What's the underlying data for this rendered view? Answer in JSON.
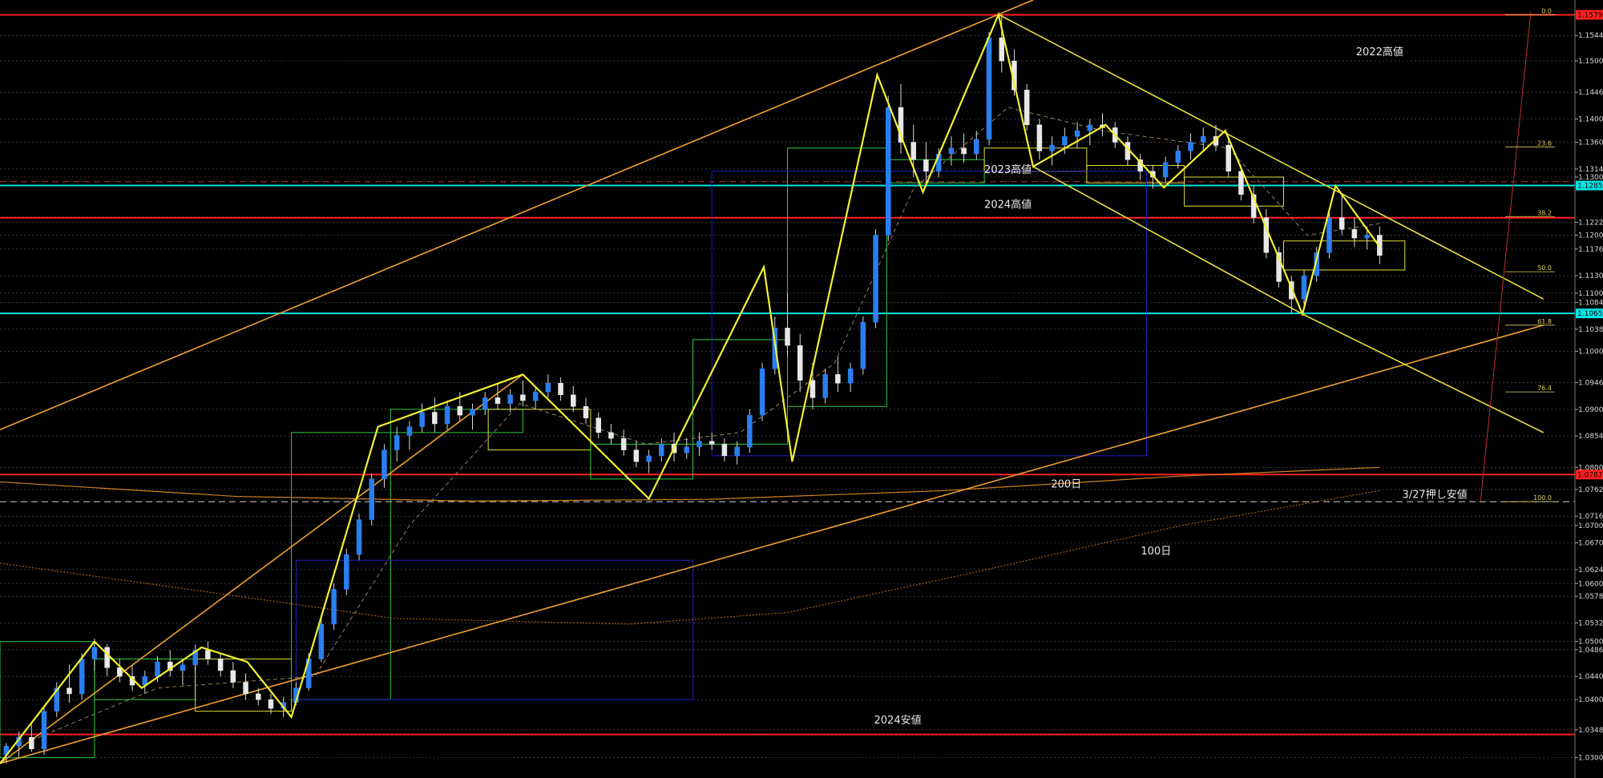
{
  "chart_data": {
    "type": "candlestick",
    "symbol": "",
    "yaxis": {
      "range": [
        1.0265,
        1.1605
      ],
      "tick_labels": [
        {
          "label": "1.15440",
          "value": 1.1544
        },
        {
          "label": "1.15000",
          "value": 1.15
        },
        {
          "label": "1.14460",
          "value": 1.1446
        },
        {
          "label": "1.14000",
          "value": 1.14
        },
        {
          "label": "1.13600",
          "value": 1.136
        },
        {
          "label": "1.13140",
          "value": 1.1314
        },
        {
          "label": "1.13000",
          "value": 1.13
        },
        {
          "label": "1.12220",
          "value": 1.1222
        },
        {
          "label": "1.12000",
          "value": 1.12
        },
        {
          "label": "1.11760",
          "value": 1.1176
        },
        {
          "label": "1.11300",
          "value": 1.113
        },
        {
          "label": "1.11000",
          "value": 1.11
        },
        {
          "label": "1.10840",
          "value": 1.1084
        },
        {
          "label": "1.10380",
          "value": 1.1038
        },
        {
          "label": "1.10000",
          "value": 1.1
        },
        {
          "label": "1.09460",
          "value": 1.0946
        },
        {
          "label": "1.09000",
          "value": 1.09
        },
        {
          "label": "1.08540",
          "value": 1.0854
        },
        {
          "label": "1.08000",
          "value": 1.08
        },
        {
          "label": "1.07620",
          "value": 1.0762
        },
        {
          "label": "1.07160",
          "value": 1.0716
        },
        {
          "label": "1.07000",
          "value": 1.07
        },
        {
          "label": "1.06700",
          "value": 1.067
        },
        {
          "label": "1.06240",
          "value": 1.0624
        },
        {
          "label": "1.06000",
          "value": 1.06
        },
        {
          "label": "1.05780",
          "value": 1.0578
        },
        {
          "label": "1.05320",
          "value": 1.0532
        },
        {
          "label": "1.05000",
          "value": 1.05
        },
        {
          "label": "1.04860",
          "value": 1.0486
        },
        {
          "label": "1.04400",
          "value": 1.044
        },
        {
          "label": "1.04000",
          "value": 1.04
        },
        {
          "label": "1.03480",
          "value": 1.0348
        },
        {
          "label": "1.03000",
          "value": 1.03
        }
      ],
      "highlight_labels": [
        {
          "label": "1.15795",
          "value": 1.15795,
          "color": "#ff2020"
        },
        {
          "label": "1.12855",
          "value": 1.12855,
          "color": "#00e5e5"
        },
        {
          "label": "1.10652",
          "value": 1.10652,
          "color": "#00e5e5"
        },
        {
          "label": "1.07876",
          "value": 1.07876,
          "color": "#ff2020"
        }
      ]
    },
    "horizontal_levels": [
      {
        "value": 1.15795,
        "color": "#ff2020",
        "style": "solid"
      },
      {
        "value": 1.12855,
        "color": "#00e5e5",
        "style": "solid"
      },
      {
        "value": 1.123,
        "color": "#ff2020",
        "style": "solid"
      },
      {
        "value": 1.10652,
        "color": "#00e5e5",
        "style": "solid"
      },
      {
        "value": 1.07876,
        "color": "#ff2020",
        "style": "solid"
      },
      {
        "value": 1.034,
        "color": "#ff2020",
        "style": "solid"
      },
      {
        "value": 1.1292,
        "color": "#b03030",
        "style": "dashed"
      },
      {
        "value": 1.0741,
        "color": "#d8d8d8",
        "style": "dashed"
      }
    ],
    "annotations": [
      {
        "text": "2022高値",
        "x": 0.876,
        "y": 1.151
      },
      {
        "text": "2023高値",
        "x": 0.64,
        "y": 1.1307
      },
      {
        "text": "2024高値",
        "x": 0.64,
        "y": 1.1247
      },
      {
        "text": "200日",
        "x": 0.677,
        "y": 1.0765
      },
      {
        "text": "3/27押し安値",
        "x": 0.911,
        "y": 1.0747
      },
      {
        "text": "100日",
        "x": 0.734,
        "y": 1.065
      },
      {
        "text": "2024安値",
        "x": 0.57,
        "y": 1.0359
      }
    ],
    "fibonacci": [
      {
        "label": "0.0",
        "value": 1.15795
      },
      {
        "label": "23.6",
        "value": 1.1352
      },
      {
        "label": "38.2",
        "value": 1.1232
      },
      {
        "label": "50.0",
        "value": 1.1137
      },
      {
        "label": "61.8",
        "value": 1.1045
      },
      {
        "label": "76.4",
        "value": 1.093
      },
      {
        "label": "100.0",
        "value": 1.0741
      }
    ],
    "zigzag": [
      [
        0.0,
        1.029
      ],
      [
        0.06,
        1.05
      ],
      [
        0.09,
        1.042
      ],
      [
        0.128,
        1.049
      ],
      [
        0.157,
        1.0465
      ],
      [
        0.185,
        1.037
      ],
      [
        0.24,
        1.087
      ],
      [
        0.332,
        1.096
      ],
      [
        0.412,
        1.0746
      ],
      [
        0.485,
        1.1145
      ],
      [
        0.503,
        1.081
      ],
      [
        0.557,
        1.1476
      ],
      [
        0.586,
        1.1274
      ],
      [
        0.634,
        1.158
      ],
      [
        0.656,
        1.1318
      ],
      [
        0.702,
        1.139
      ],
      [
        0.739,
        1.1282
      ],
      [
        0.778,
        1.138
      ],
      [
        0.827,
        1.1064
      ],
      [
        0.848,
        1.1285
      ],
      [
        0.876,
        1.118
      ]
    ],
    "ohlc": [
      [
        0.004,
        1.0305,
        1.0325,
        1.029,
        1.032
      ],
      [
        0.012,
        1.032,
        1.0345,
        1.03,
        1.0335
      ],
      [
        0.02,
        1.0335,
        1.036,
        1.031,
        1.0315
      ],
      [
        0.028,
        1.0315,
        1.039,
        1.0305,
        1.038
      ],
      [
        0.036,
        1.038,
        1.043,
        1.037,
        1.042
      ],
      [
        0.044,
        1.042,
        1.046,
        1.0395,
        1.041
      ],
      [
        0.052,
        1.041,
        1.048,
        1.04,
        1.047
      ],
      [
        0.06,
        1.047,
        1.0505,
        1.045,
        1.049
      ],
      [
        0.068,
        1.049,
        1.0495,
        1.044,
        1.0455
      ],
      [
        0.076,
        1.0455,
        1.047,
        1.043,
        1.044
      ],
      [
        0.084,
        1.044,
        1.046,
        1.0415,
        1.0425
      ],
      [
        0.092,
        1.0425,
        1.045,
        1.041,
        1.044
      ],
      [
        0.1,
        1.044,
        1.0475,
        1.043,
        1.0465
      ],
      [
        0.108,
        1.0465,
        1.0485,
        1.044,
        1.045
      ],
      [
        0.116,
        1.045,
        1.047,
        1.0425,
        1.046
      ],
      [
        0.124,
        1.046,
        1.0495,
        1.045,
        1.0485
      ],
      [
        0.132,
        1.0485,
        1.05,
        1.046,
        1.047
      ],
      [
        0.14,
        1.047,
        1.048,
        1.044,
        1.045
      ],
      [
        0.148,
        1.045,
        1.0465,
        1.042,
        1.043
      ],
      [
        0.156,
        1.043,
        1.0445,
        1.04,
        1.041
      ],
      [
        0.164,
        1.041,
        1.042,
        1.039,
        1.04
      ],
      [
        0.172,
        1.04,
        1.041,
        1.0375,
        1.0385
      ],
      [
        0.18,
        1.0385,
        1.0405,
        1.037,
        1.0395
      ],
      [
        0.188,
        1.0395,
        1.043,
        1.039,
        1.042
      ],
      [
        0.196,
        1.042,
        1.048,
        1.0415,
        1.047
      ],
      [
        0.204,
        1.047,
        1.054,
        1.0465,
        1.053
      ],
      [
        0.212,
        1.053,
        1.06,
        1.052,
        1.059
      ],
      [
        0.22,
        1.059,
        1.066,
        1.058,
        1.065
      ],
      [
        0.228,
        1.065,
        1.072,
        1.064,
        1.071
      ],
      [
        0.236,
        1.071,
        1.079,
        1.07,
        1.078
      ],
      [
        0.244,
        1.078,
        1.084,
        1.0765,
        1.083
      ],
      [
        0.252,
        1.083,
        1.087,
        1.081,
        1.0855
      ],
      [
        0.26,
        1.0855,
        1.088,
        1.083,
        1.087
      ],
      [
        0.268,
        1.087,
        1.091,
        1.086,
        1.0895
      ],
      [
        0.276,
        1.0895,
        1.092,
        1.086,
        1.0875
      ],
      [
        0.284,
        1.0875,
        1.0915,
        1.0865,
        1.0905
      ],
      [
        0.292,
        1.0905,
        1.093,
        1.088,
        1.089
      ],
      [
        0.3,
        1.089,
        1.091,
        1.0865,
        1.09
      ],
      [
        0.308,
        1.09,
        1.093,
        1.089,
        1.092
      ],
      [
        0.316,
        1.092,
        1.0945,
        1.09,
        1.091
      ],
      [
        0.324,
        1.091,
        1.0935,
        1.0895,
        1.0925
      ],
      [
        0.332,
        1.0925,
        1.095,
        1.0905,
        1.0915
      ],
      [
        0.34,
        1.0915,
        1.094,
        1.09,
        1.093
      ],
      [
        0.348,
        1.093,
        1.096,
        1.092,
        1.0945
      ],
      [
        0.356,
        1.0945,
        1.0955,
        1.0915,
        1.0925
      ],
      [
        0.364,
        1.0925,
        1.094,
        1.0895,
        1.0905
      ],
      [
        0.372,
        1.0905,
        1.092,
        1.0875,
        1.0885
      ],
      [
        0.38,
        1.0885,
        1.0895,
        1.085,
        1.086
      ],
      [
        0.388,
        1.086,
        1.0875,
        1.084,
        1.085
      ],
      [
        0.396,
        1.085,
        1.0865,
        1.082,
        1.083
      ],
      [
        0.404,
        1.083,
        1.0845,
        1.08,
        1.081
      ],
      [
        0.412,
        1.081,
        1.083,
        1.079,
        1.082
      ],
      [
        0.42,
        1.082,
        1.085,
        1.081,
        1.084
      ],
      [
        0.428,
        1.084,
        1.086,
        1.081,
        1.0825
      ],
      [
        0.436,
        1.0825,
        1.085,
        1.0815,
        1.0835
      ],
      [
        0.444,
        1.0835,
        1.086,
        1.082,
        1.0845
      ],
      [
        0.452,
        1.0845,
        1.086,
        1.083,
        1.084
      ],
      [
        0.46,
        1.084,
        1.085,
        1.081,
        1.082
      ],
      [
        0.468,
        1.082,
        1.0845,
        1.0805,
        1.0835
      ],
      [
        0.476,
        1.0835,
        1.09,
        1.0825,
        1.089
      ],
      [
        0.484,
        1.089,
        1.098,
        1.088,
        1.097
      ],
      [
        0.492,
        1.097,
        1.106,
        1.096,
        1.104
      ],
      [
        0.5,
        1.104,
        1.11,
        1.099,
        1.101
      ],
      [
        0.508,
        1.101,
        1.103,
        1.093,
        1.095
      ],
      [
        0.516,
        1.095,
        1.098,
        1.09,
        1.092
      ],
      [
        0.524,
        1.092,
        1.097,
        1.091,
        1.096
      ],
      [
        0.532,
        1.096,
        1.099,
        1.093,
        1.0945
      ],
      [
        0.54,
        1.0945,
        1.098,
        1.093,
        1.097
      ],
      [
        0.548,
        1.097,
        1.106,
        1.096,
        1.105
      ],
      [
        0.556,
        1.105,
        1.121,
        1.104,
        1.12
      ],
      [
        0.564,
        1.12,
        1.144,
        1.119,
        1.142
      ],
      [
        0.572,
        1.142,
        1.146,
        1.134,
        1.136
      ],
      [
        0.58,
        1.136,
        1.139,
        1.13,
        1.133
      ],
      [
        0.588,
        1.133,
        1.136,
        1.129,
        1.131
      ],
      [
        0.596,
        1.131,
        1.135,
        1.13,
        1.134
      ],
      [
        0.604,
        1.134,
        1.137,
        1.132,
        1.135
      ],
      [
        0.612,
        1.135,
        1.1375,
        1.1325,
        1.134
      ],
      [
        0.62,
        1.134,
        1.138,
        1.133,
        1.1365
      ],
      [
        0.628,
        1.1365,
        1.155,
        1.1355,
        1.154
      ],
      [
        0.636,
        1.154,
        1.158,
        1.148,
        1.15
      ],
      [
        0.644,
        1.15,
        1.152,
        1.144,
        1.145
      ],
      [
        0.652,
        1.145,
        1.146,
        1.138,
        1.139
      ],
      [
        0.66,
        1.139,
        1.14,
        1.133,
        1.1345
      ],
      [
        0.668,
        1.1345,
        1.137,
        1.132,
        1.1355
      ],
      [
        0.676,
        1.1355,
        1.1385,
        1.134,
        1.137
      ],
      [
        0.684,
        1.137,
        1.1395,
        1.135,
        1.138
      ],
      [
        0.692,
        1.138,
        1.14,
        1.1355,
        1.139
      ],
      [
        0.7,
        1.139,
        1.141,
        1.137,
        1.1385
      ],
      [
        0.708,
        1.1385,
        1.1395,
        1.135,
        1.136
      ],
      [
        0.716,
        1.136,
        1.137,
        1.132,
        1.133
      ],
      [
        0.724,
        1.133,
        1.134,
        1.1295,
        1.131
      ],
      [
        0.732,
        1.131,
        1.132,
        1.128,
        1.13
      ],
      [
        0.74,
        1.13,
        1.1335,
        1.129,
        1.1325
      ],
      [
        0.748,
        1.1325,
        1.1355,
        1.1315,
        1.1345
      ],
      [
        0.756,
        1.1345,
        1.1375,
        1.133,
        1.136
      ],
      [
        0.764,
        1.136,
        1.1385,
        1.1345,
        1.137
      ],
      [
        0.772,
        1.137,
        1.139,
        1.1345,
        1.1355
      ],
      [
        0.78,
        1.1355,
        1.137,
        1.13,
        1.131
      ],
      [
        0.788,
        1.131,
        1.132,
        1.126,
        1.127
      ],
      [
        0.796,
        1.127,
        1.1285,
        1.122,
        1.123
      ],
      [
        0.804,
        1.123,
        1.1245,
        1.116,
        1.117
      ],
      [
        0.812,
        1.117,
        1.118,
        1.111,
        1.112
      ],
      [
        0.82,
        1.112,
        1.113,
        1.1065,
        1.109
      ],
      [
        0.828,
        1.109,
        1.114,
        1.108,
        1.113
      ],
      [
        0.836,
        1.113,
        1.118,
        1.112,
        1.117
      ],
      [
        0.844,
        1.117,
        1.124,
        1.116,
        1.123
      ],
      [
        0.852,
        1.123,
        1.127,
        1.12,
        1.121
      ],
      [
        0.86,
        1.121,
        1.123,
        1.118,
        1.1195
      ],
      [
        0.868,
        1.1195,
        1.1215,
        1.1175,
        1.12
      ],
      [
        0.876,
        1.12,
        1.1215,
        1.115,
        1.1165
      ]
    ]
  }
}
